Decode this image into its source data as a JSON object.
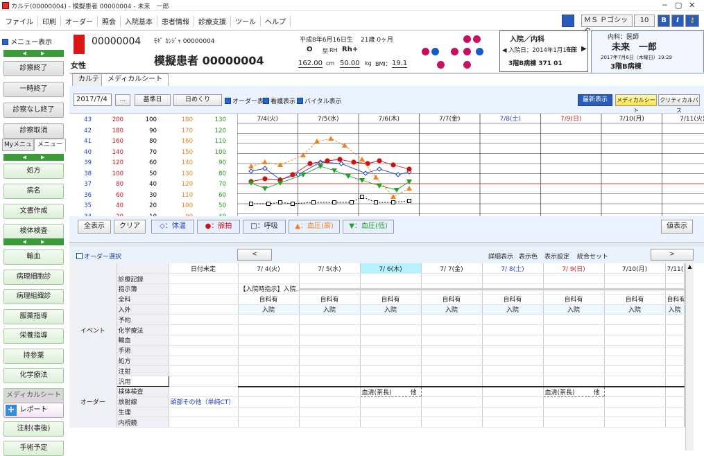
{
  "window": {
    "title": "カルテ(00000004) - 模擬患者 00000004 - 未来　一郎",
    "min": "─",
    "max": "▢",
    "close": "✕"
  },
  "menu": [
    "ファイル",
    "印刷",
    "オーダー",
    "照会",
    "入院基本",
    "患者情報",
    "診療支援",
    "ツール",
    "ヘルプ"
  ],
  "toolbar": {
    "font": "ＭＳ Ｐゴシック",
    "size": "10",
    "bold": "B",
    "italic": "I"
  },
  "left": {
    "menu_toggle": "メニュー表示",
    "buttons_top": [
      "診察終了",
      "一時終了",
      "診察なし終了",
      "診察取消"
    ],
    "tabs": [
      "Myメニュー",
      "メニュー"
    ],
    "buttons_mid": [
      "処方",
      "病名",
      "文書作成",
      "検体検査"
    ],
    "buttons_bottom": [
      "輸血",
      "病理細胞診",
      "病理組織診",
      "服薬指導",
      "栄養指導",
      "持参薬",
      "化学療法",
      "メディカルシート"
    ],
    "report": "レポート",
    "buttons_last": [
      "注射(事後)",
      "手術予定"
    ]
  },
  "patient": {
    "id": "00000004",
    "kana": "ﾓｷﾞ ｶﾝｼﾞｬ 00000004",
    "name": "模擬患者 00000004",
    "sex": "女性",
    "dob": "平成8年6月16日生",
    "age": "21歳 0ヶ月",
    "blood": "O",
    "blood_type_label": "型",
    "rh_label": "RH",
    "rh": "Rh+",
    "height": "162.00",
    "height_unit": "cm",
    "weight": "50.00",
    "weight_unit": "kg",
    "bmi_label": "BMI：",
    "bmi": "19.1",
    "admission": "入院／内科",
    "admit_date": "入院日：2014年1月14日",
    "admit_status": "在院",
    "ward": "3階B病棟 371 01",
    "dept_doctor": "内科：医師",
    "user": "未来　一郎",
    "date_line": "2017年7月6日（木曜日）19:29",
    "user_ward": "3階B病棟"
  },
  "tabs": [
    "カルテ",
    "メディカルシート"
  ],
  "controls": {
    "date": "2017/7/4",
    "ellipsis": "...",
    "base": "基準日",
    "flip": "日めくり",
    "check_order": "オーダー表示",
    "check_nursing": "看護表示",
    "check_vital": "バイタル表示",
    "latest": "最新表示",
    "medical": "メディカルシート",
    "clinical": "クリティカルパス"
  },
  "scales": {
    "temp": [
      "43",
      "42",
      "41",
      "40",
      "39",
      "38",
      "37",
      "36",
      "35",
      "34"
    ],
    "pulse": [
      "200",
      "180",
      "160",
      "140",
      "120",
      "100",
      "80",
      "60",
      "40",
      "20"
    ],
    "resp": [
      "100",
      "90",
      "80",
      "70",
      "60",
      "50",
      "40",
      "30",
      "20",
      "10"
    ],
    "bp_high": [
      "180",
      "170",
      "160",
      "150",
      "140",
      "130",
      "120",
      "110",
      "100",
      "90"
    ],
    "bp_low": [
      "130",
      "120",
      "110",
      "100",
      "90",
      "80",
      "70",
      "60",
      "50",
      "40"
    ],
    "colors": {
      "temp": "#2040c0",
      "pulse": "#d01010",
      "resp": "#000000",
      "bp_high": "#f08020",
      "bp_low": "#20a020"
    }
  },
  "dates": [
    {
      "label": "7/4(火)",
      "color": "#222"
    },
    {
      "label": "7/5(水)",
      "color": "#222"
    },
    {
      "label": "7/6(木)",
      "color": "#222"
    },
    {
      "label": "7/7(金)",
      "color": "#222"
    },
    {
      "label": "7/8(土)",
      "color": "#2040d0"
    },
    {
      "label": "7/9(日)",
      "color": "#d02020"
    },
    {
      "label": "7/10(月)",
      "color": "#222"
    },
    {
      "label": "7/11(火)",
      "color": "#222"
    }
  ],
  "legend": {
    "all": "全表示",
    "clear": "クリア",
    "temp": "◇：体温",
    "pulse": "●：脈拍",
    "resp": "□：呼吸",
    "bp_high": "▲：血圧(高)",
    "bp_low": "▼：血圧(低)",
    "values": "値表示"
  },
  "order": {
    "select": "オーダー選択",
    "prev": "<",
    "next": ">",
    "detail": "詳細表示",
    "display_color": "表示色",
    "settings": "表示設定",
    "integrated": "統合セット"
  },
  "grid": {
    "unscheduled": "日付未定",
    "dates": [
      "7/ 4(火)",
      "7/ 5(水)",
      "7/ 6(木)",
      "7/ 7(金)",
      "7/ 8(土)",
      "7/ 9(日)",
      "7/10(月)",
      "7/11(火)"
    ],
    "event_group": "イベント",
    "order_group": "オーダー",
    "rows": [
      {
        "label": "診療記録",
        "cells": [
          "",
          "",
          "",
          "",
          "",
          "",
          "",
          "",
          ""
        ]
      },
      {
        "label": "指示簿",
        "cells": [
          "",
          "【入院時指示】入院…",
          "",
          "",
          "",
          "",
          "",
          "",
          ""
        ]
      },
      {
        "label": "全科",
        "cells": [
          "",
          "自科有",
          "自科有",
          "自科有",
          "自科有",
          "自科有",
          "自科有",
          "自科有",
          "自科有"
        ]
      },
      {
        "label": "入外",
        "cells": [
          "",
          "入院",
          "入院",
          "入院",
          "入院",
          "入院",
          "入院",
          "入院",
          "入院"
        ]
      },
      {
        "label": "予約",
        "cells": [
          "",
          "",
          "",
          "",
          "",
          "",
          "",
          "",
          ""
        ]
      },
      {
        "label": "化学療法",
        "cells": [
          "",
          "",
          "",
          "",
          "",
          "",
          "",
          "",
          ""
        ]
      },
      {
        "label": "輸血",
        "cells": [
          "",
          "",
          "",
          "",
          "",
          "",
          "",
          "",
          ""
        ]
      },
      {
        "label": "手術",
        "cells": [
          "",
          "",
          "",
          "",
          "",
          "",
          "",
          "",
          ""
        ]
      },
      {
        "label": "処方",
        "cells": [
          "",
          "",
          "",
          "",
          "",
          "",
          "",
          "",
          ""
        ]
      },
      {
        "label": "注射",
        "cells": [
          "",
          "",
          "",
          "",
          "",
          "",
          "",
          "",
          ""
        ]
      },
      {
        "label": "汎用",
        "cells": [
          "",
          "",
          "",
          "",
          "",
          "",
          "",
          "",
          ""
        ]
      },
      {
        "label": "検体検査",
        "cells": [
          "",
          "",
          "",
          "血清(茶長)　　　他",
          "",
          "",
          "血清(茶長)　　　他",
          "",
          ""
        ]
      },
      {
        "label": "放射線",
        "cells": [
          "頭部その他（単純CT）",
          "",
          "",
          "",
          "",
          "",
          "",
          "",
          ""
        ]
      },
      {
        "label": "生理",
        "cells": [
          "",
          "",
          "",
          "",
          "",
          "",
          "",
          "",
          ""
        ]
      },
      {
        "label": "内視鏡",
        "cells": [
          "",
          "",
          "",
          "",
          "",
          "",
          "",
          "",
          ""
        ]
      }
    ]
  }
}
